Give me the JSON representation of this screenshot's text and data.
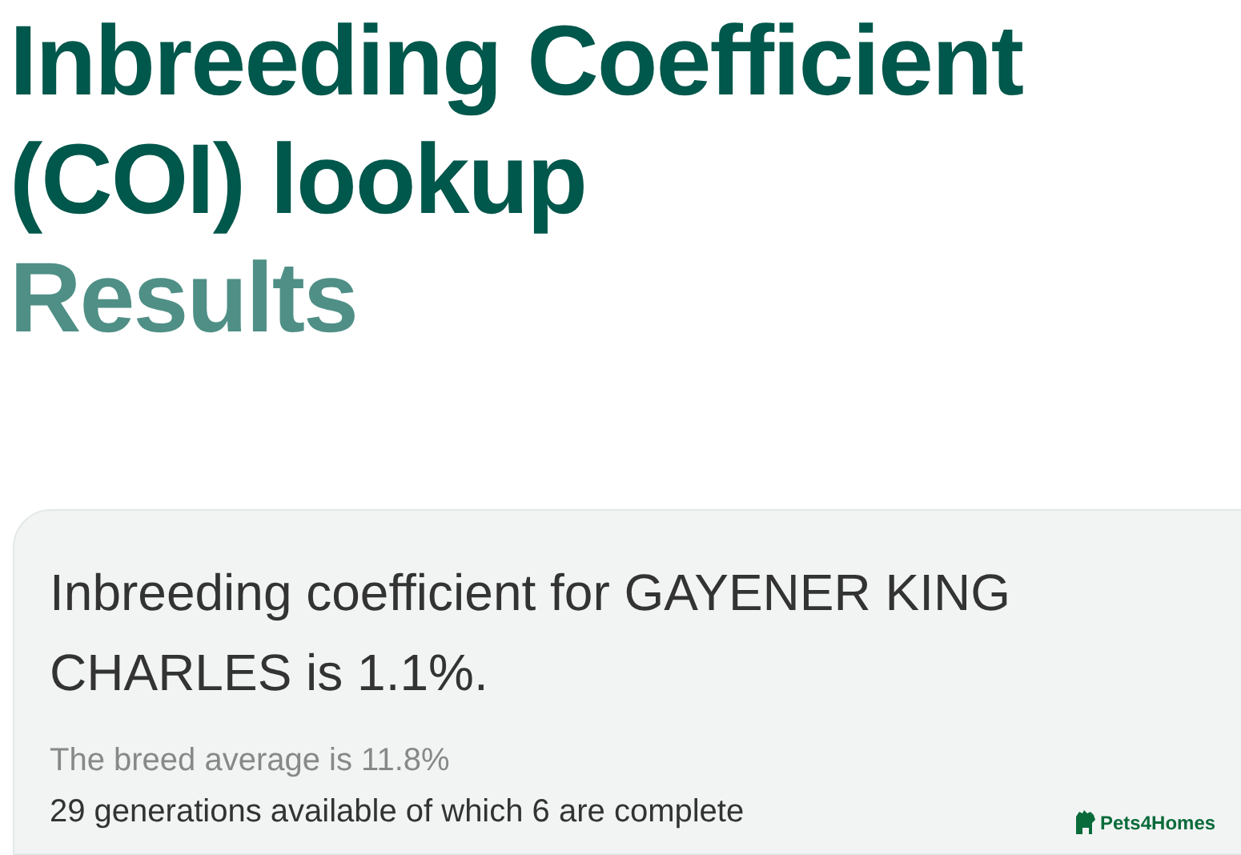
{
  "heading": {
    "title_lines": [
      "Inbreeding Coefficient",
      "(COI) lookup"
    ],
    "subtitle": "Results"
  },
  "result_card": {
    "statement": "Inbreeding coefficient for GAYENER KING CHARLES is 1.1%.",
    "breed_average": "The breed average is 11.8%",
    "generations": "29 generations available of which 6 are complete",
    "logo": "Pets4Homes"
  }
}
